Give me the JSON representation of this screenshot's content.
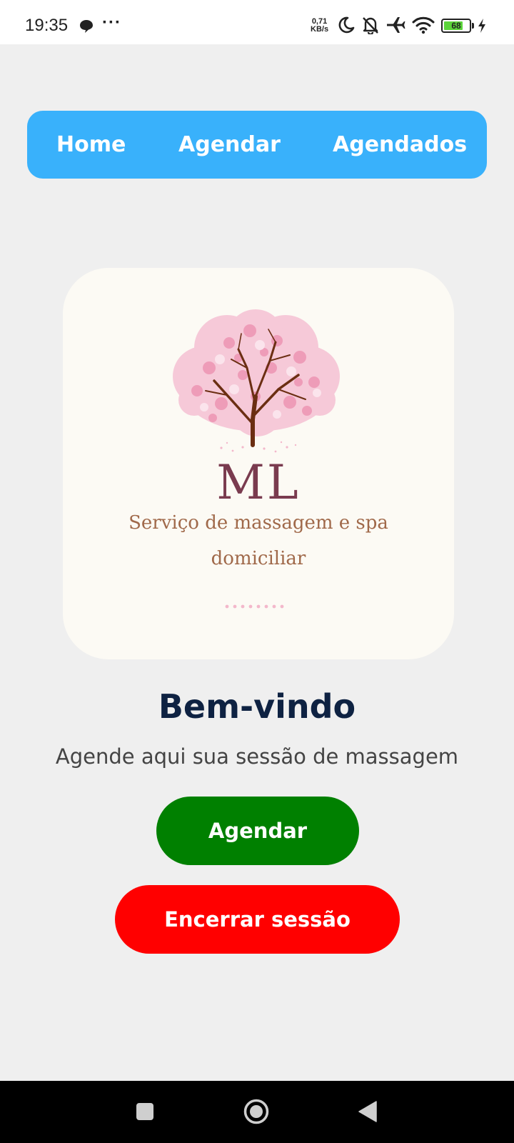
{
  "status_bar": {
    "time": "19:35",
    "dots": "···",
    "network_speed_value": "0,71",
    "network_speed_unit": "KB/s",
    "battery_level": "68",
    "icons": [
      "chat-bubble-icon",
      "moon-icon",
      "bell-off-icon",
      "airplane-icon",
      "wifi-icon",
      "battery-icon",
      "charging-icon"
    ]
  },
  "nav": {
    "tabs": [
      {
        "label": "Home"
      },
      {
        "label": "Agendar"
      },
      {
        "label": "Agendados"
      }
    ]
  },
  "logo": {
    "monogram": "ML",
    "tagline_line1": "Serviço de massagem e spa",
    "tagline_line2": "domiciliar"
  },
  "main": {
    "title": "Bem-vindo",
    "subtitle": "Agende aqui sua sessão de massagem"
  },
  "buttons": {
    "schedule_label": "Agendar",
    "logout_label": "Encerrar sessão"
  },
  "system_nav": {
    "icons": [
      "recents-square-icon",
      "home-circle-icon",
      "back-triangle-icon"
    ]
  },
  "colors": {
    "nav_background": "#39b1fb",
    "background": "#efefef",
    "title": "#0e2242",
    "schedule_button": "#008000",
    "logout_button": "#ff0000",
    "logo_card": "#fcfaf4",
    "monogram": "#7a3b4f",
    "tagline": "#a0694a"
  }
}
